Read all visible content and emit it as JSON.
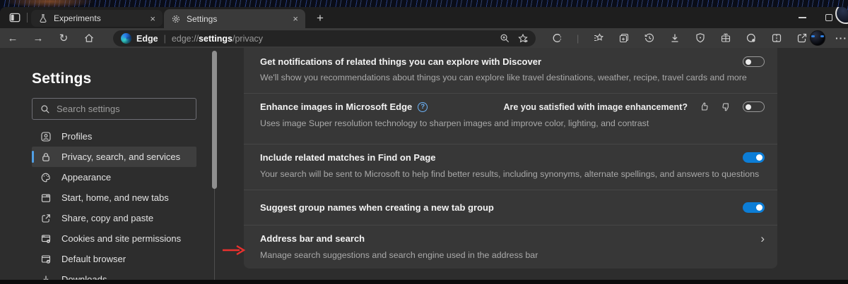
{
  "colors": {
    "accent": "#0c7dd6",
    "toggle-on": "#0c7dd6",
    "selected-bar": "#519fe5",
    "arrow-red": "#e8312e",
    "help-blue": "#6cb2f7"
  },
  "tabbar": {
    "tabs": [
      {
        "label": "Experiments"
      },
      {
        "label": "Settings"
      }
    ],
    "close_glyph": "×",
    "new_tab_glyph": "+"
  },
  "toolbar": {
    "back_glyph": "←",
    "forward_glyph": "→",
    "refresh_glyph": "↻",
    "brand": "Edge",
    "divider": "|",
    "url_scheme": "edge://",
    "url_host": "settings",
    "url_path": "/privacy",
    "more_glyph": "···"
  },
  "sidebar": {
    "title": "Settings",
    "search_placeholder": "Search settings",
    "items": [
      {
        "label": "Profiles"
      },
      {
        "label": "Privacy, search, and services"
      },
      {
        "label": "Appearance"
      },
      {
        "label": "Start, home, and new tabs"
      },
      {
        "label": "Share, copy and paste"
      },
      {
        "label": "Cookies and site permissions"
      },
      {
        "label": "Default browser"
      },
      {
        "label": "Downloads"
      }
    ]
  },
  "settings": {
    "rows": [
      {
        "title": "Get notifications of related things you can explore with Discover",
        "description": "We'll show you recommendations about things you can explore like travel destinations, weather, recipe, travel cards and more",
        "toggle": "off"
      },
      {
        "title": "Enhance images in Microsoft Edge",
        "help_glyph": "?",
        "feedback_question": "Are you satisfied with image enhancement?",
        "description": "Uses image Super resolution technology to sharpen images and improve color, lighting, and contrast",
        "toggle": "off"
      },
      {
        "title": "Include related matches in Find on Page",
        "description": "Your search will be sent to Microsoft to help find better results, including synonyms, alternate spellings, and answers to questions",
        "toggle": "on"
      },
      {
        "title": "Suggest group names when creating a new tab group",
        "toggle": "on"
      },
      {
        "title": "Address bar and search",
        "description": "Manage search suggestions and search engine used in the address bar",
        "chevron_glyph": "›"
      }
    ]
  }
}
